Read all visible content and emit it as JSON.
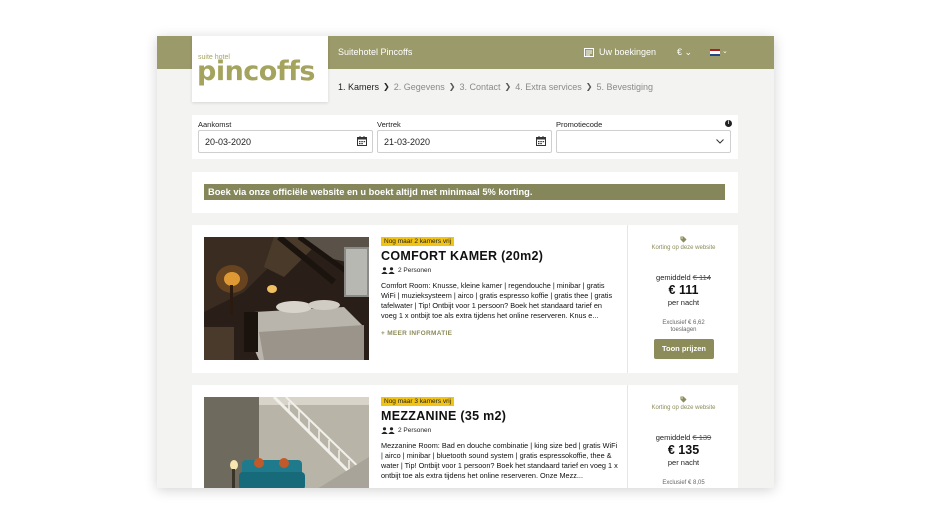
{
  "header": {
    "logo_small": "suite hotel",
    "logo_main": "pincoffs",
    "hotel_name": "Suitehotel Pincoffs",
    "bookings_label": "Uw boekingen",
    "currency": "€ ⌄",
    "language_chevron": "⌄"
  },
  "steps": [
    {
      "label": "1. Kamers",
      "active": true
    },
    {
      "label": "2. Gegevens",
      "active": false
    },
    {
      "label": "3. Contact",
      "active": false
    },
    {
      "label": "4. Extra services",
      "active": false
    },
    {
      "label": "5. Bevestiging",
      "active": false
    }
  ],
  "step_separator": "❯",
  "search": {
    "arrival_label": "Aankomst",
    "arrival_value": "20-03-2020",
    "departure_label": "Vertrek",
    "departure_value": "21-03-2020",
    "promo_label": "Promotiecode",
    "promo_value": ""
  },
  "banner_text": "Boek via onze officiële website en u boekt altijd met minimaal 5% korting.",
  "rooms": [
    {
      "badge": "Nog maar 2 kamers vrij",
      "title": "COMFORT KAMER (20m2)",
      "persons": "2 Personen",
      "description": "Comfort Room: Knusse, kleine kamer | regendouche | minibar | gratis WiFi | muzieksysteem | airco | gratis espresso koffie | gratis thee | gratis tafelwater |   Tip! Ontbijt voor 1 persoon? Boek het standaard tarief en voeg 1 x ontbijt toe als extra tijdens het online reserveren. Knus e...",
      "more_info": "+ MEER INFORMATIE",
      "discount_label": "Korting op deze website",
      "avg_label": "gemiddeld",
      "old_price": "€ 114",
      "price": "€ 111",
      "per_night": "per nacht",
      "excl_line1": "Exclusief € 6,62",
      "excl_line2": "toeslagen",
      "button_label": "Toon prijzen"
    },
    {
      "badge": "Nog maar 3 kamers vrij",
      "title": "MEZZANINE (35 m2)",
      "persons": "2 Personen",
      "description": "Mezzanine Room: Bad en douche combinatie | king size bed | gratis WiFi | airco | minibar | bluetooth sound system | gratis espressokoffie, thee & water |   Tip! Ontbijt voor 1 persoon? Boek het standaard tarief en voeg 1 x ontbijt toe als extra tijdens het online reserveren. Onze Mezz...",
      "more_info": "",
      "discount_label": "Korting op deze website",
      "avg_label": "gemiddeld",
      "old_price": "€ 139",
      "price": "€ 135",
      "per_night": "per nacht",
      "excl_line1": "Exclusief € 8,05",
      "excl_line2": "",
      "button_label": ""
    }
  ],
  "colors": {
    "brand_olive": "#9b9a6a",
    "banner_olive": "#85865a",
    "badge_yellow": "#f2c312"
  }
}
